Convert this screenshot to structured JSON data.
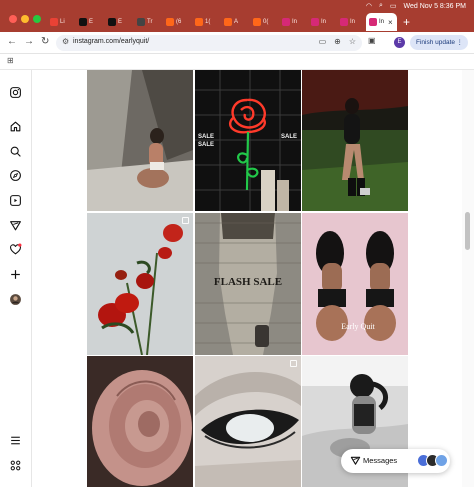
{
  "browser": {
    "tabs": [
      {
        "label": "Li",
        "icon": "gmail-icon",
        "color": "#e94235"
      },
      {
        "label": "E",
        "icon": "x-icon",
        "color": "#111111"
      },
      {
        "label": "E",
        "icon": "x-icon",
        "color": "#111111"
      },
      {
        "label": "Tr",
        "icon": "site-icon",
        "color": "#444444"
      },
      {
        "label": "(6",
        "icon": "substack-icon",
        "color": "#ff6719"
      },
      {
        "label": "1(",
        "icon": "substack-icon",
        "color": "#ff6719"
      },
      {
        "label": "A",
        "icon": "substack-icon",
        "color": "#ff6719"
      },
      {
        "label": "0(",
        "icon": "substack-icon",
        "color": "#ff6719"
      },
      {
        "label": "In",
        "icon": "instagram-icon",
        "color": "#d62976"
      },
      {
        "label": "In",
        "icon": "instagram-icon",
        "color": "#d62976"
      },
      {
        "label": "In",
        "icon": "instagram-icon",
        "color": "#d62976"
      }
    ],
    "active_tab": {
      "label": "In",
      "icon": "instagram-icon",
      "close": "×"
    },
    "new_tab": "+",
    "clock": "Wed Nov 5  8:36 PM",
    "url": "instagram.com/earlyquit/",
    "profile_initial": "E",
    "finish_update": "Finish update",
    "menu_dots": "⋮"
  },
  "grid": {
    "tiles": [
      {
        "name": "woman-on-white-sheets-photo",
        "multi": false
      },
      {
        "name": "neon-rose-sign-photo",
        "multi": false,
        "text": "SALE"
      },
      {
        "name": "woman-in-black-bodysuit-night-photo",
        "multi": false
      },
      {
        "name": "red-roses-photo",
        "multi": true
      },
      {
        "name": "flash-sale-collage",
        "multi": false,
        "text": "FLASH SALE"
      },
      {
        "name": "early-quit-collage",
        "multi": false,
        "text": "Early Quit"
      },
      {
        "name": "pink-rose-closeup-photo",
        "multi": false
      },
      {
        "name": "white-eye-closeup-photo",
        "multi": true
      },
      {
        "name": "woman-in-bed-bw-photo",
        "multi": false
      }
    ]
  },
  "messages": {
    "label": "Messages"
  },
  "colors": {
    "chrome_bar": "#a73d30",
    "accent": "#1b3a7a"
  }
}
